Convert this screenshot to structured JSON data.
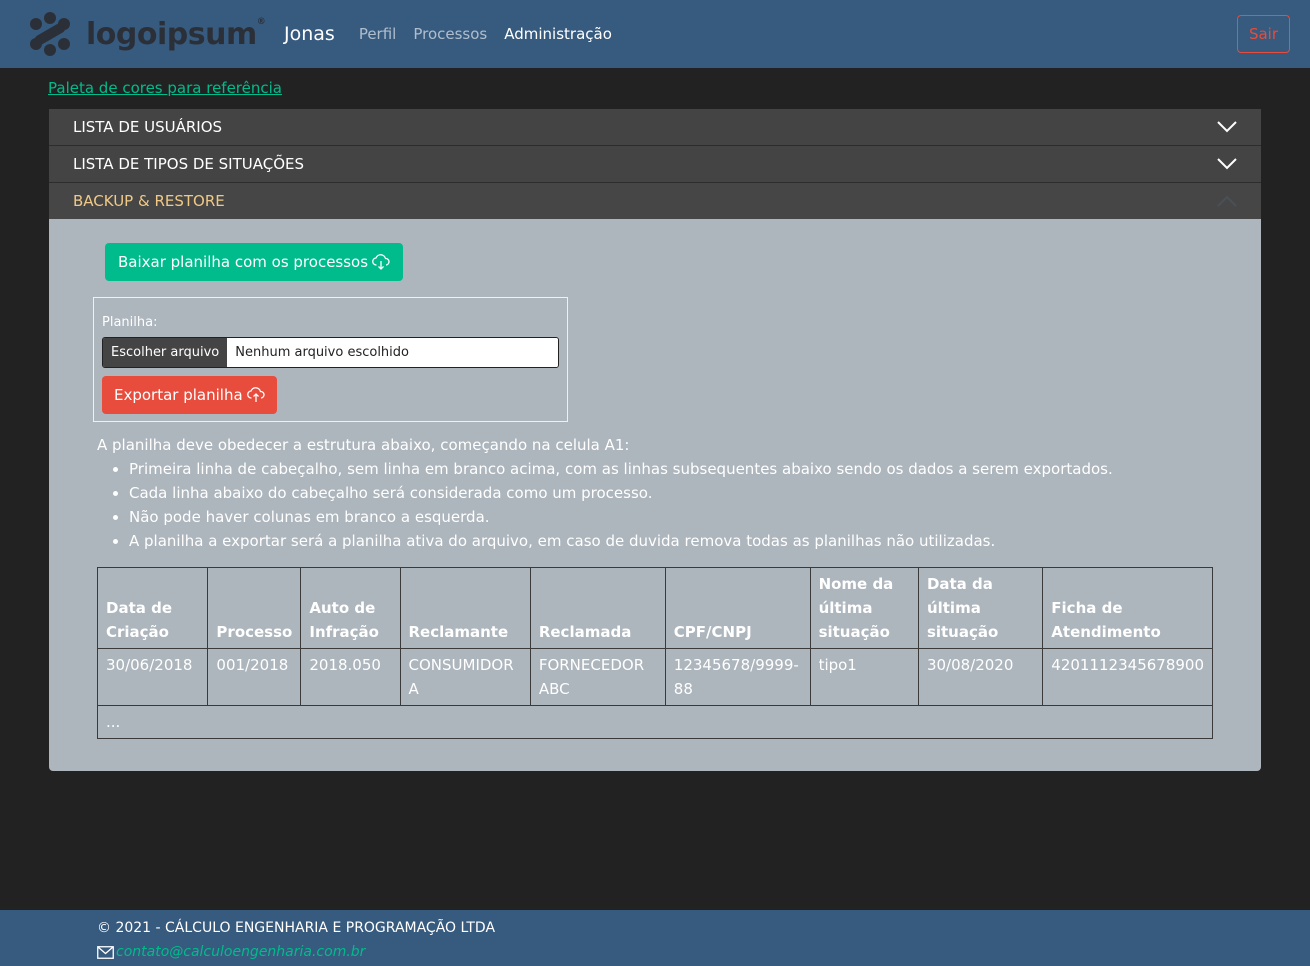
{
  "nav": {
    "logo_text": "logoipsum",
    "user": "Jonas",
    "links": [
      "Perfil",
      "Processos",
      "Administração"
    ],
    "logout": "Sair"
  },
  "palette_link": "Paleta de cores para referência",
  "accordion": {
    "sections": [
      "LISTA DE USUÁRIOS",
      "LISTA DE TIPOS DE SITUAÇÕES",
      "BACKUP & RESTORE"
    ]
  },
  "backup": {
    "download_label": "Baixar planilha com os processos",
    "upload_label": "Planilha:",
    "file_button": "Escolher arquivo",
    "file_name": "Nenhum arquivo escolhido",
    "export_label": "Exportar planilha",
    "intro": "A planilha deve obedecer a estrutura abaixo, começando na celula A1:",
    "rules": [
      "Primeira linha de cabeçalho, sem linha em branco acima, com as linhas subsequentes abaixo sendo os dados a serem exportados.",
      "Cada linha abaixo do cabeçalho será considerada como um processo.",
      "Não pode haver colunas em branco a esquerda.",
      "A planilha a exportar será a planilha ativa do arquivo, em caso de duvida remova todas as planilhas não utilizadas."
    ]
  },
  "table": {
    "headers": [
      "Data de Criação",
      "Processo",
      "Auto de Infração",
      "Reclamante",
      "Reclamada",
      "CPF/CNPJ",
      "Nome da última situação",
      "Data da última situação",
      "Ficha de Atendimento"
    ],
    "row": [
      "30/06/2018",
      "001/2018",
      "2018.050",
      "CONSUMIDOR A",
      "FORNECEDOR ABC",
      "12345678/9999-88",
      "tipo1",
      "30/08/2020",
      "4201112345678900"
    ],
    "ellipsis": "..."
  },
  "footer": {
    "copyright": "© 2021 - CÁLCULO ENGENHARIA E PROGRAMAÇÃO LTDA",
    "email": "contato@calculoengenharia.com.br"
  },
  "colors": {
    "navbar": "#375a7f",
    "background": "#222222",
    "success": "#00bc8c",
    "danger": "#e74c3c",
    "panel": "#adb5bd"
  }
}
